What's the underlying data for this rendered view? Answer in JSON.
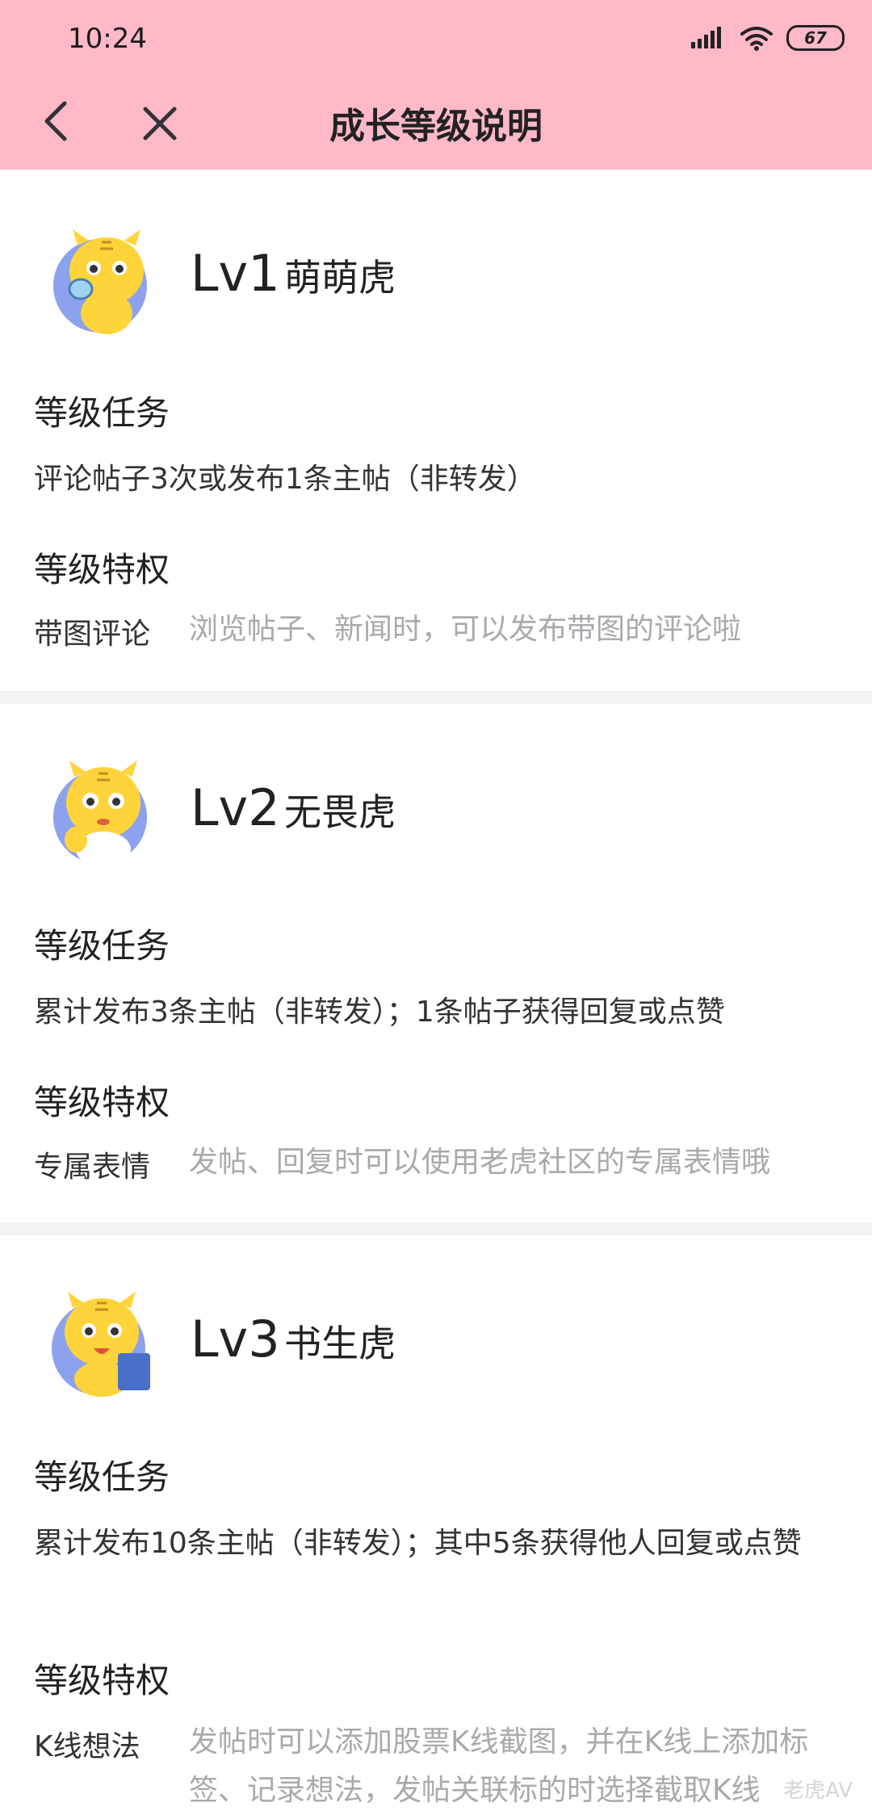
{
  "status_bar": {
    "time": "10:24",
    "battery": "67"
  },
  "nav": {
    "title": "成长等级说明"
  },
  "levels": [
    {
      "lv": "Lv1",
      "name": "萌萌虎",
      "task_heading": "等级任务",
      "task": "评论帖子3次或发布1条主帖（非转发）",
      "privilege_heading": "等级特权",
      "privilege_label": "带图评论",
      "privilege_desc": "浏览帖子、新闻时，可以发布带图的评论啦"
    },
    {
      "lv": "Lv2",
      "name": "无畏虎",
      "task_heading": "等级任务",
      "task": "累计发布3条主帖（非转发）；1条帖子获得回复或点赞",
      "privilege_heading": "等级特权",
      "privilege_label": "专属表情",
      "privilege_desc": "发帖、回复时可以使用老虎社区的专属表情哦"
    },
    {
      "lv": "Lv3",
      "name": "书生虎",
      "task_heading": "等级任务",
      "task": "累计发布10条主帖（非转发）；其中5条获得他人回复或点赞",
      "privilege_heading": "等级特权",
      "privilege_label": "K线想法",
      "privilege_desc": "发帖时可以添加股票K线截图，并在K线上添加标签、记录想法，发帖关联标的时选择截取K线"
    }
  ],
  "watermark": "老虎AV",
  "colors": {
    "header": "#ffb9c7",
    "avatar_bg": "#8da2ee",
    "tiger": "#ffd43a",
    "muted_text": "#a9a9ae"
  }
}
